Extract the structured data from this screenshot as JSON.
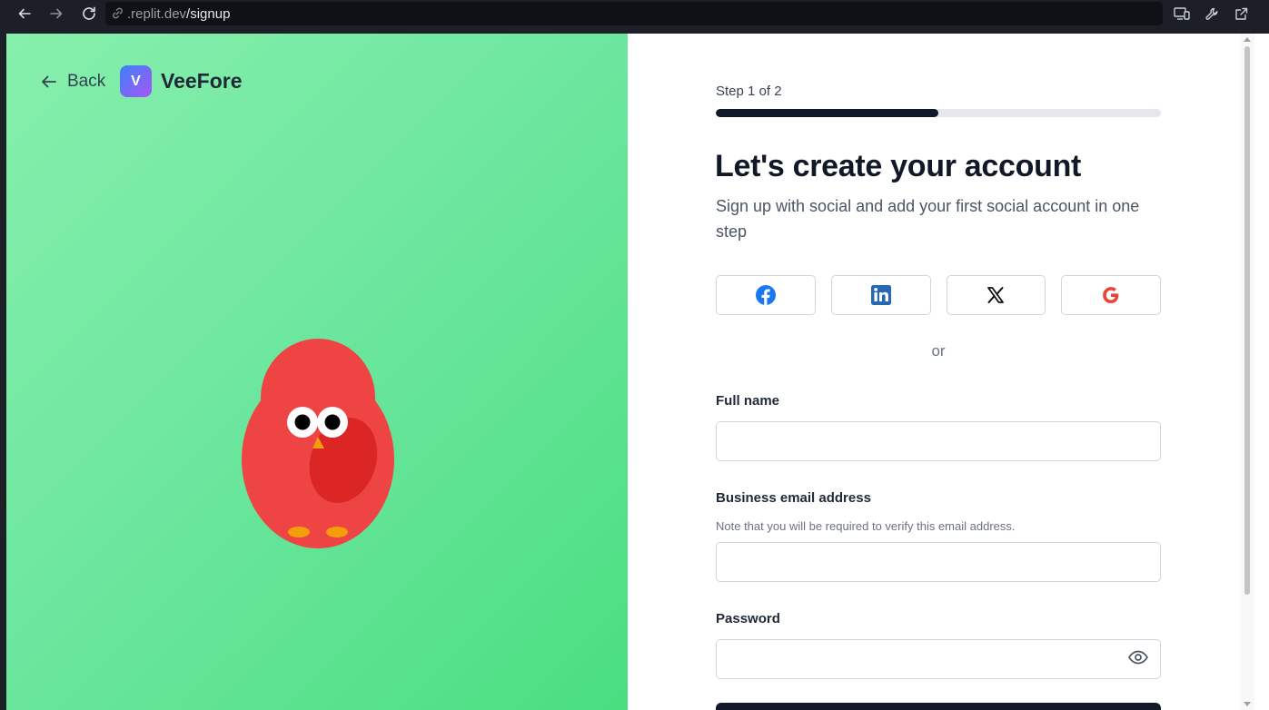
{
  "browser": {
    "url_muted": ".replit.dev",
    "url_path": "/signup"
  },
  "brand": {
    "back_label": "Back",
    "logo_letter": "V",
    "name": "VeeFore"
  },
  "signup": {
    "step_label": "Step 1 of 2",
    "progress_fraction": 0.5,
    "title": "Let's create your account",
    "subtitle": "Sign up with social and add your first social account in one step",
    "social_buttons": [
      "facebook-icon",
      "linkedin-icon",
      "x-icon",
      "google-icon"
    ],
    "divider": "or",
    "full_name_label": "Full name",
    "full_name_value": "",
    "email_label": "Business email address",
    "email_hint": "Note that you will be required to verify this email address.",
    "email_value": "",
    "password_label": "Password",
    "password_value": ""
  },
  "colors": {
    "hero_green": "#4ade80",
    "mascot_red": "#ef4444",
    "primary_dark": "#111827"
  }
}
